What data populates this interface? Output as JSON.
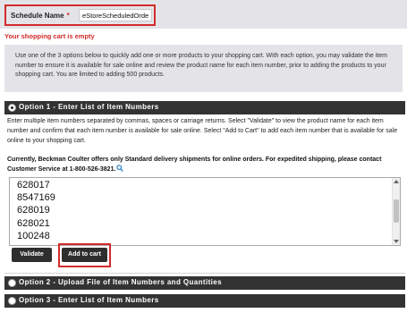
{
  "schedule": {
    "label": "Schedule Name",
    "required_mark": "*",
    "value": "eStoreScheduledOrder"
  },
  "cart_status": "Your shopping cart is empty",
  "info": {
    "text": "Use one of the 3 options below to quickly add one or more products to your shopping cart. With each option, you may validate the item number to ensure it is available for sale online and review the product name for each item number, prior to adding the products to your shopping cart. You are limited to adding 500 products."
  },
  "options": [
    {
      "label": "Option 1 - Enter List of Item Numbers",
      "selected": true,
      "description": "Enter multiple item numbers separated by commas, spaces or carriage returns. Select \"Validate\" to view the product name for each item number and confirm that each item number is available for sale online. Select \"Add to Cart\" to add each item number that is available for sale online to your shopping cart.",
      "notice": "Currently, Beckman Coulter offers only Standard delivery shipments for online orders. For expedited shipping, please contact Customer Service at 1-800-526-3821.",
      "items": [
        "628017",
        "8547169",
        "628019",
        "628021",
        "100248"
      ],
      "validate_label": "Validate",
      "add_to_cart_label": "Add to cart"
    },
    {
      "label": "Option 2 - Upload File of Item Numbers and Quantities",
      "selected": false
    },
    {
      "label": "Option 3 - Enter List of Item Numbers",
      "selected": false
    }
  ],
  "icons": {
    "notice_icon": "search-icon",
    "radio": "radio-button"
  },
  "colors": {
    "highlight": "#d22b2b",
    "header_bg": "#333333",
    "panel_bg": "#e4e4e8"
  }
}
